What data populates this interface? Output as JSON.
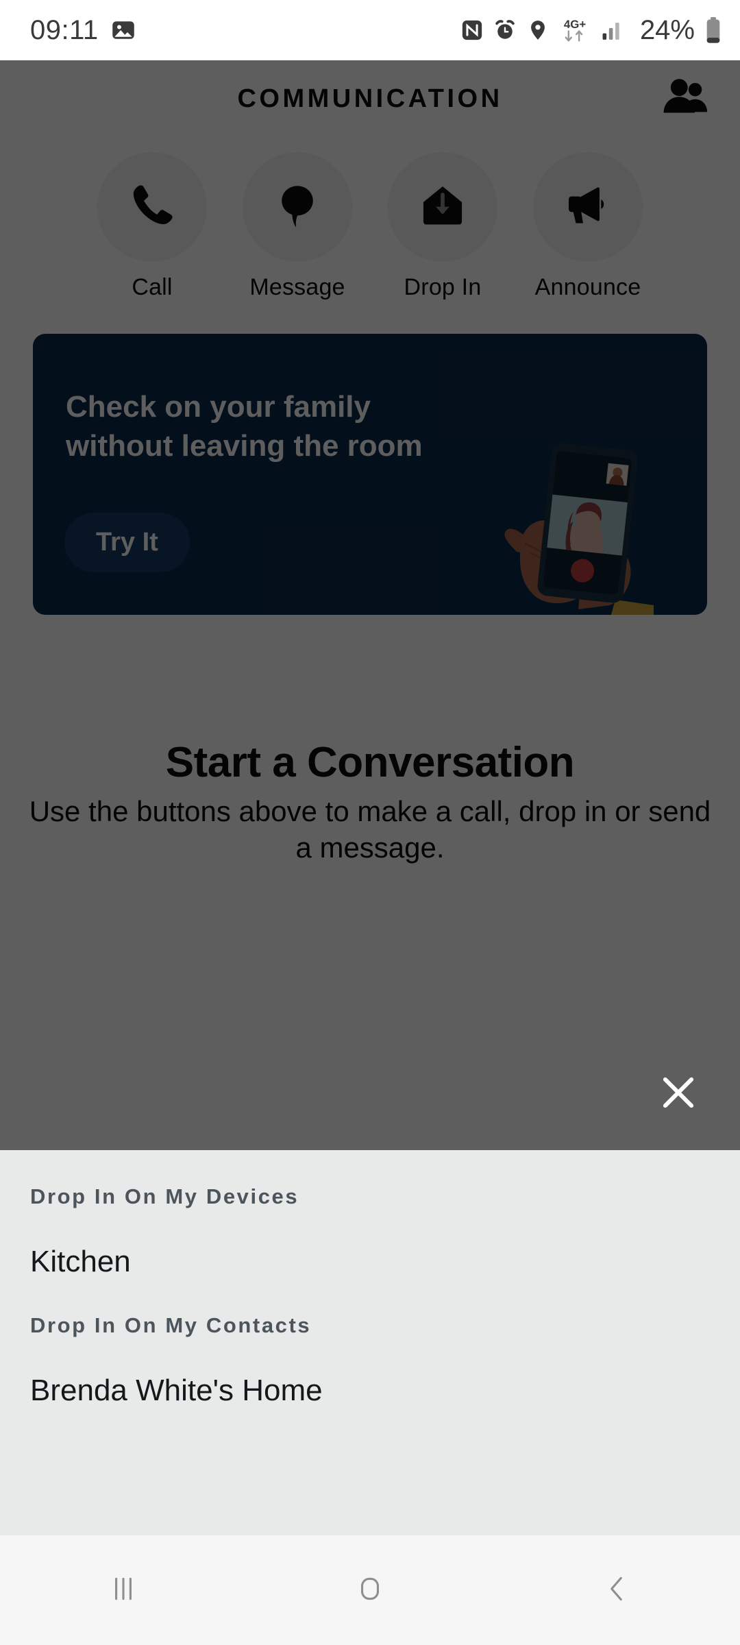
{
  "status_bar": {
    "time": "09:11",
    "battery_percent": "24%",
    "network": "4G+",
    "icons": [
      "gallery-icon",
      "nfc-icon",
      "alarm-icon",
      "location-icon",
      "network-4g-plus-icon",
      "signal-bars-icon",
      "battery-icon"
    ],
    "text_color": "#3a3a3a"
  },
  "app": {
    "title": "COMMUNICATION",
    "contacts_icon": "contacts-people-icon",
    "actions": [
      {
        "label": "Call",
        "icon": "phone-icon"
      },
      {
        "label": "Message",
        "icon": "speech-bubble-icon"
      },
      {
        "label": "Drop In",
        "icon": "house-down-arrow-icon"
      },
      {
        "label": "Announce",
        "icon": "megaphone-icon"
      }
    ],
    "promo": {
      "title": "Check on your family without leaving the room",
      "button_label": "Try It",
      "background_color": "#0d2a4d",
      "button_color": "#143a64",
      "illustration": "hand-holding-phone-video-call-illustration"
    },
    "empty_state": {
      "title": "Start a Conversation",
      "subtitle": "Use the buttons above to make a call, drop in or send a message."
    }
  },
  "overlay": {
    "dim_color": "rgba(0,0,0,0.63)",
    "close_icon": "close-x-icon"
  },
  "bottom_sheet": {
    "background_color": "#e8eaea",
    "sections": [
      {
        "title": "Drop In On My Devices",
        "items": [
          {
            "label": "Kitchen"
          }
        ]
      },
      {
        "title": "Drop In On My Contacts",
        "items": [
          {
            "label": "Brenda White's Home"
          }
        ]
      }
    ]
  },
  "nav_bar": {
    "background_color": "#f6f6f6",
    "buttons": [
      {
        "name": "recents",
        "icon": "recents-lines-icon"
      },
      {
        "name": "home",
        "icon": "home-square-icon"
      },
      {
        "name": "back",
        "icon": "back-chevron-icon"
      }
    ]
  }
}
